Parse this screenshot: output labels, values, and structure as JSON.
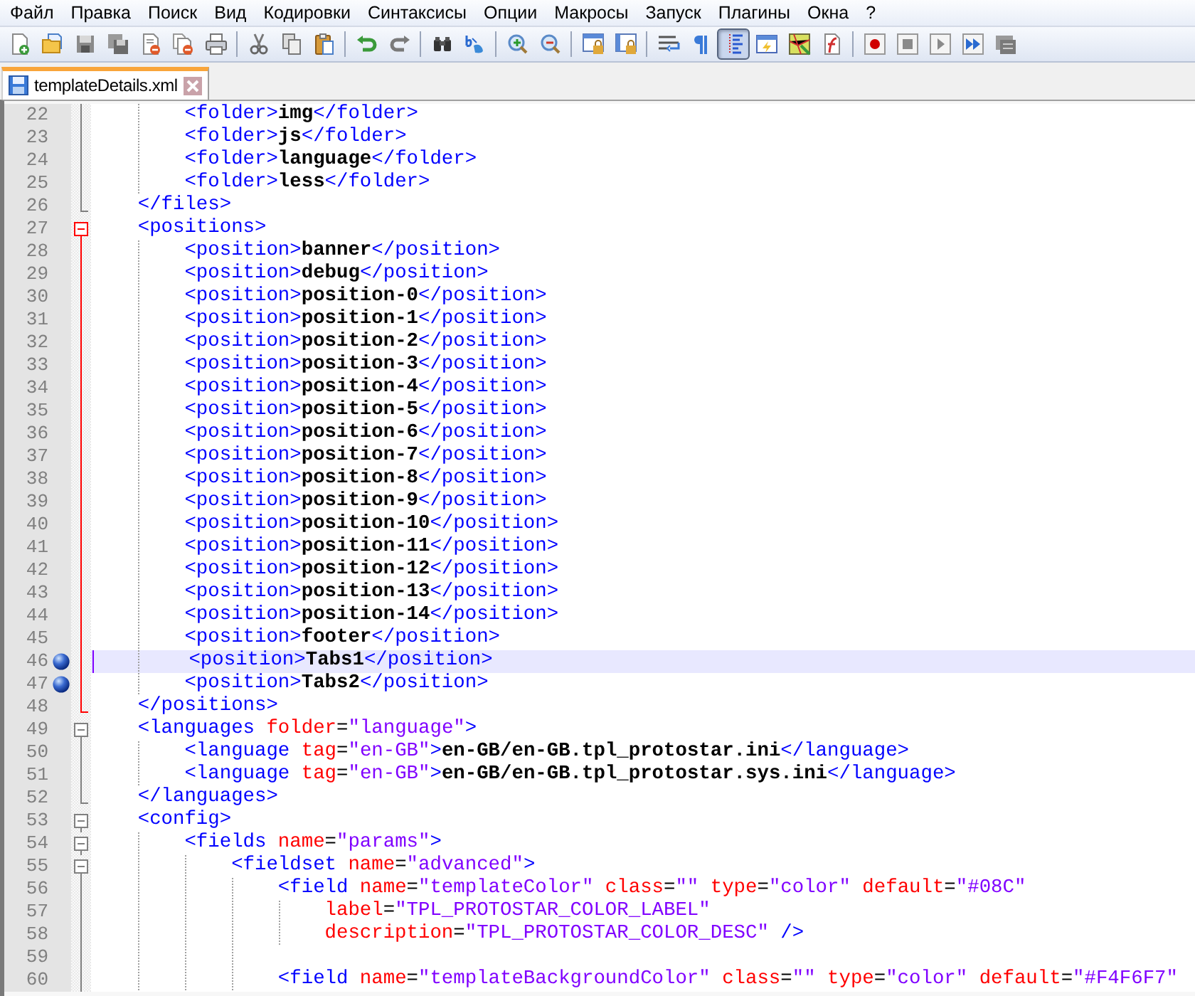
{
  "menu": [
    {
      "label": "Файл"
    },
    {
      "label": "Правка"
    },
    {
      "label": "Поиск"
    },
    {
      "label": "Вид"
    },
    {
      "label": "Кодировки"
    },
    {
      "label": "Синтаксисы"
    },
    {
      "label": "Опции"
    },
    {
      "label": "Макросы"
    },
    {
      "label": "Запуск"
    },
    {
      "label": "Плагины"
    },
    {
      "label": "Окна"
    },
    {
      "label": "?"
    }
  ],
  "toolbar": [
    {
      "kind": "new",
      "pressed": false
    },
    {
      "kind": "open",
      "pressed": false
    },
    {
      "kind": "save",
      "pressed": false
    },
    {
      "kind": "save-all",
      "pressed": false
    },
    {
      "kind": "close",
      "pressed": false
    },
    {
      "kind": "close-all",
      "pressed": false
    },
    {
      "kind": "print",
      "pressed": false
    },
    {
      "kind": "separator"
    },
    {
      "kind": "cut",
      "pressed": false
    },
    {
      "kind": "copy",
      "pressed": false
    },
    {
      "kind": "paste",
      "pressed": false
    },
    {
      "kind": "separator"
    },
    {
      "kind": "undo",
      "pressed": false
    },
    {
      "kind": "redo",
      "pressed": false
    },
    {
      "kind": "separator"
    },
    {
      "kind": "find",
      "pressed": false
    },
    {
      "kind": "replace",
      "pressed": false
    },
    {
      "kind": "separator"
    },
    {
      "kind": "zoom-in",
      "pressed": false
    },
    {
      "kind": "zoom-out",
      "pressed": false
    },
    {
      "kind": "separator"
    },
    {
      "kind": "sync-vertical",
      "pressed": false
    },
    {
      "kind": "sync-horizontal",
      "pressed": false
    },
    {
      "kind": "separator"
    },
    {
      "kind": "wrap",
      "pressed": false
    },
    {
      "kind": "all-chars",
      "pressed": false
    },
    {
      "kind": "indent-guide",
      "pressed": true
    },
    {
      "kind": "language",
      "pressed": false
    },
    {
      "kind": "doc-map",
      "pressed": false
    },
    {
      "kind": "function-list",
      "pressed": false
    },
    {
      "kind": "separator"
    },
    {
      "kind": "record",
      "pressed": false
    },
    {
      "kind": "stop",
      "pressed": false
    },
    {
      "kind": "play",
      "pressed": false
    },
    {
      "kind": "play-multiple",
      "pressed": false
    },
    {
      "kind": "save-macro",
      "pressed": false
    }
  ],
  "tabs": [
    {
      "title": "templateDetails.xml",
      "selected": true
    }
  ],
  "lines": [
    {
      "number": "22",
      "kind": "body",
      "highlighted": false,
      "bookmark": false,
      "current": false,
      "tokens": [
        {
          "kind": "tag",
          "text": "        <folder>"
        },
        {
          "kind": "text",
          "text": "img"
        },
        {
          "kind": "tag",
          "text": "</folder>"
        }
      ]
    },
    {
      "number": "23",
      "kind": "body",
      "highlighted": false,
      "bookmark": false,
      "current": false,
      "tokens": [
        {
          "kind": "tag",
          "text": "        <folder>"
        },
        {
          "kind": "text",
          "text": "js"
        },
        {
          "kind": "tag",
          "text": "</folder>"
        }
      ]
    },
    {
      "number": "24",
      "kind": "body",
      "highlighted": false,
      "bookmark": false,
      "current": false,
      "tokens": [
        {
          "kind": "tag",
          "text": "        <folder>"
        },
        {
          "kind": "text",
          "text": "language"
        },
        {
          "kind": "tag",
          "text": "</folder>"
        }
      ]
    },
    {
      "number": "25",
      "kind": "body",
      "highlighted": false,
      "bookmark": false,
      "current": false,
      "tokens": [
        {
          "kind": "tag",
          "text": "        <folder>"
        },
        {
          "kind": "text",
          "text": "less"
        },
        {
          "kind": "tag",
          "text": "</folder>"
        }
      ]
    },
    {
      "number": "26",
      "kind": "end",
      "highlighted": false,
      "bookmark": false,
      "current": false,
      "tokens": [
        {
          "kind": "tag",
          "text": "    </files>"
        }
      ]
    },
    {
      "number": "27",
      "kind": "open",
      "highlighted": true,
      "bookmark": false,
      "current": false,
      "tokens": [
        {
          "kind": "tag",
          "text": "    <positions>"
        }
      ]
    },
    {
      "number": "28",
      "kind": "body",
      "highlighted": true,
      "bookmark": false,
      "current": false,
      "tokens": [
        {
          "kind": "tag",
          "text": "        <position>"
        },
        {
          "kind": "text",
          "text": "banner"
        },
        {
          "kind": "tag",
          "text": "</position>"
        }
      ]
    },
    {
      "number": "29",
      "kind": "body",
      "highlighted": true,
      "bookmark": false,
      "current": false,
      "tokens": [
        {
          "kind": "tag",
          "text": "        <position>"
        },
        {
          "kind": "text",
          "text": "debug"
        },
        {
          "kind": "tag",
          "text": "</position>"
        }
      ]
    },
    {
      "number": "30",
      "kind": "body",
      "highlighted": true,
      "bookmark": false,
      "current": false,
      "tokens": [
        {
          "kind": "tag",
          "text": "        <position>"
        },
        {
          "kind": "text",
          "text": "position-0"
        },
        {
          "kind": "tag",
          "text": "</position>"
        }
      ]
    },
    {
      "number": "31",
      "kind": "body",
      "highlighted": true,
      "bookmark": false,
      "current": false,
      "tokens": [
        {
          "kind": "tag",
          "text": "        <position>"
        },
        {
          "kind": "text",
          "text": "position-1"
        },
        {
          "kind": "tag",
          "text": "</position>"
        }
      ]
    },
    {
      "number": "32",
      "kind": "body",
      "highlighted": true,
      "bookmark": false,
      "current": false,
      "tokens": [
        {
          "kind": "tag",
          "text": "        <position>"
        },
        {
          "kind": "text",
          "text": "position-2"
        },
        {
          "kind": "tag",
          "text": "</position>"
        }
      ]
    },
    {
      "number": "33",
      "kind": "body",
      "highlighted": true,
      "bookmark": false,
      "current": false,
      "tokens": [
        {
          "kind": "tag",
          "text": "        <position>"
        },
        {
          "kind": "text",
          "text": "position-3"
        },
        {
          "kind": "tag",
          "text": "</position>"
        }
      ]
    },
    {
      "number": "34",
      "kind": "body",
      "highlighted": true,
      "bookmark": false,
      "current": false,
      "tokens": [
        {
          "kind": "tag",
          "text": "        <position>"
        },
        {
          "kind": "text",
          "text": "position-4"
        },
        {
          "kind": "tag",
          "text": "</position>"
        }
      ]
    },
    {
      "number": "35",
      "kind": "body",
      "highlighted": true,
      "bookmark": false,
      "current": false,
      "tokens": [
        {
          "kind": "tag",
          "text": "        <position>"
        },
        {
          "kind": "text",
          "text": "position-5"
        },
        {
          "kind": "tag",
          "text": "</position>"
        }
      ]
    },
    {
      "number": "36",
      "kind": "body",
      "highlighted": true,
      "bookmark": false,
      "current": false,
      "tokens": [
        {
          "kind": "tag",
          "text": "        <position>"
        },
        {
          "kind": "text",
          "text": "position-6"
        },
        {
          "kind": "tag",
          "text": "</position>"
        }
      ]
    },
    {
      "number": "37",
      "kind": "body",
      "highlighted": true,
      "bookmark": false,
      "current": false,
      "tokens": [
        {
          "kind": "tag",
          "text": "        <position>"
        },
        {
          "kind": "text",
          "text": "position-7"
        },
        {
          "kind": "tag",
          "text": "</position>"
        }
      ]
    },
    {
      "number": "38",
      "kind": "body",
      "highlighted": true,
      "bookmark": false,
      "current": false,
      "tokens": [
        {
          "kind": "tag",
          "text": "        <position>"
        },
        {
          "kind": "text",
          "text": "position-8"
        },
        {
          "kind": "tag",
          "text": "</position>"
        }
      ]
    },
    {
      "number": "39",
      "kind": "body",
      "highlighted": true,
      "bookmark": false,
      "current": false,
      "tokens": [
        {
          "kind": "tag",
          "text": "        <position>"
        },
        {
          "kind": "text",
          "text": "position-9"
        },
        {
          "kind": "tag",
          "text": "</position>"
        }
      ]
    },
    {
      "number": "40",
      "kind": "body",
      "highlighted": true,
      "bookmark": false,
      "current": false,
      "tokens": [
        {
          "kind": "tag",
          "text": "        <position>"
        },
        {
          "kind": "text",
          "text": "position-10"
        },
        {
          "kind": "tag",
          "text": "</position>"
        }
      ]
    },
    {
      "number": "41",
      "kind": "body",
      "highlighted": true,
      "bookmark": false,
      "current": false,
      "tokens": [
        {
          "kind": "tag",
          "text": "        <position>"
        },
        {
          "kind": "text",
          "text": "position-11"
        },
        {
          "kind": "tag",
          "text": "</position>"
        }
      ]
    },
    {
      "number": "42",
      "kind": "body",
      "highlighted": true,
      "bookmark": false,
      "current": false,
      "tokens": [
        {
          "kind": "tag",
          "text": "        <position>"
        },
        {
          "kind": "text",
          "text": "position-12"
        },
        {
          "kind": "tag",
          "text": "</position>"
        }
      ]
    },
    {
      "number": "43",
      "kind": "body",
      "highlighted": true,
      "bookmark": false,
      "current": false,
      "tokens": [
        {
          "kind": "tag",
          "text": "        <position>"
        },
        {
          "kind": "text",
          "text": "position-13"
        },
        {
          "kind": "tag",
          "text": "</position>"
        }
      ]
    },
    {
      "number": "44",
      "kind": "body",
      "highlighted": true,
      "bookmark": false,
      "current": false,
      "tokens": [
        {
          "kind": "tag",
          "text": "        <position>"
        },
        {
          "kind": "text",
          "text": "position-14"
        },
        {
          "kind": "tag",
          "text": "</position>"
        }
      ]
    },
    {
      "number": "45",
      "kind": "body",
      "highlighted": true,
      "bookmark": false,
      "current": false,
      "tokens": [
        {
          "kind": "tag",
          "text": "        <position>"
        },
        {
          "kind": "text",
          "text": "footer"
        },
        {
          "kind": "tag",
          "text": "</position>"
        }
      ]
    },
    {
      "number": "46",
      "kind": "body",
      "highlighted": true,
      "bookmark": true,
      "current": true,
      "tokens": [
        {
          "kind": "tag",
          "text": "        <position>"
        },
        {
          "kind": "text",
          "text": "Tabs1"
        },
        {
          "kind": "tag",
          "text": "</position>"
        }
      ]
    },
    {
      "number": "47",
      "kind": "body",
      "highlighted": true,
      "bookmark": true,
      "current": false,
      "tokens": [
        {
          "kind": "tag",
          "text": "        <position>"
        },
        {
          "kind": "text",
          "text": "Tabs2"
        },
        {
          "kind": "tag",
          "text": "</position>"
        }
      ]
    },
    {
      "number": "48",
      "kind": "end",
      "highlighted": true,
      "bookmark": false,
      "current": false,
      "tokens": [
        {
          "kind": "tag",
          "text": "    </positions>"
        }
      ]
    },
    {
      "number": "49",
      "kind": "open",
      "highlighted": false,
      "bookmark": false,
      "current": false,
      "tokens": [
        {
          "kind": "tag",
          "text": "    <languages "
        },
        {
          "kind": "attr",
          "text": "folder"
        },
        {
          "kind": "symbol",
          "text": "="
        },
        {
          "kind": "value",
          "text": "\"language\""
        },
        {
          "kind": "tag",
          "text": ">"
        }
      ]
    },
    {
      "number": "50",
      "kind": "body",
      "highlighted": false,
      "bookmark": false,
      "current": false,
      "tokens": [
        {
          "kind": "tag",
          "text": "        <language "
        },
        {
          "kind": "attr",
          "text": "tag"
        },
        {
          "kind": "symbol",
          "text": "="
        },
        {
          "kind": "value",
          "text": "\"en-GB\""
        },
        {
          "kind": "tag",
          "text": ">"
        },
        {
          "kind": "text",
          "text": "en-GB/en-GB.tpl_protostar.ini"
        },
        {
          "kind": "tag",
          "text": "</language>"
        }
      ]
    },
    {
      "number": "51",
      "kind": "body",
      "highlighted": false,
      "bookmark": false,
      "current": false,
      "tokens": [
        {
          "kind": "tag",
          "text": "        <language "
        },
        {
          "kind": "attr",
          "text": "tag"
        },
        {
          "kind": "symbol",
          "text": "="
        },
        {
          "kind": "value",
          "text": "\"en-GB\""
        },
        {
          "kind": "tag",
          "text": ">"
        },
        {
          "kind": "text",
          "text": "en-GB/en-GB.tpl_protostar.sys.ini"
        },
        {
          "kind": "tag",
          "text": "</language>"
        }
      ]
    },
    {
      "number": "52",
      "kind": "end",
      "highlighted": false,
      "bookmark": false,
      "current": false,
      "tokens": [
        {
          "kind": "tag",
          "text": "    </languages>"
        }
      ]
    },
    {
      "number": "53",
      "kind": "open",
      "highlighted": false,
      "bookmark": false,
      "current": false,
      "tokens": [
        {
          "kind": "tag",
          "text": "    <config>"
        }
      ]
    },
    {
      "number": "54",
      "kind": "open",
      "highlighted": false,
      "bookmark": false,
      "current": false,
      "tokens": [
        {
          "kind": "tag",
          "text": "        <fields "
        },
        {
          "kind": "attr",
          "text": "name"
        },
        {
          "kind": "symbol",
          "text": "="
        },
        {
          "kind": "value",
          "text": "\"params\""
        },
        {
          "kind": "tag",
          "text": ">"
        }
      ]
    },
    {
      "number": "55",
      "kind": "open",
      "highlighted": false,
      "bookmark": false,
      "current": false,
      "tokens": [
        {
          "kind": "tag",
          "text": "            <fieldset "
        },
        {
          "kind": "attr",
          "text": "name"
        },
        {
          "kind": "symbol",
          "text": "="
        },
        {
          "kind": "value",
          "text": "\"advanced\""
        },
        {
          "kind": "tag",
          "text": ">"
        }
      ]
    },
    {
      "number": "56",
      "kind": "body",
      "highlighted": false,
      "bookmark": false,
      "current": false,
      "tokens": [
        {
          "kind": "tag",
          "text": "                <field "
        },
        {
          "kind": "attr",
          "text": "name"
        },
        {
          "kind": "symbol",
          "text": "="
        },
        {
          "kind": "value",
          "text": "\"templateColor\" "
        },
        {
          "kind": "attr",
          "text": "class"
        },
        {
          "kind": "symbol",
          "text": "="
        },
        {
          "kind": "value",
          "text": "\"\" "
        },
        {
          "kind": "attr",
          "text": "type"
        },
        {
          "kind": "symbol",
          "text": "="
        },
        {
          "kind": "value",
          "text": "\"color\" "
        },
        {
          "kind": "attr",
          "text": "default"
        },
        {
          "kind": "symbol",
          "text": "="
        },
        {
          "kind": "value",
          "text": "\"#08C\""
        }
      ]
    },
    {
      "number": "57",
      "kind": "body",
      "highlighted": false,
      "bookmark": false,
      "current": false,
      "tokens": [
        {
          "kind": "attr",
          "text": "                    label"
        },
        {
          "kind": "symbol",
          "text": "="
        },
        {
          "kind": "value",
          "text": "\"TPL_PROTOSTAR_COLOR_LABEL\""
        }
      ]
    },
    {
      "number": "58",
      "kind": "body",
      "highlighted": false,
      "bookmark": false,
      "current": false,
      "tokens": [
        {
          "kind": "attr",
          "text": "                    description"
        },
        {
          "kind": "symbol",
          "text": "="
        },
        {
          "kind": "value",
          "text": "\"TPL_PROTOSTAR_COLOR_DESC\" "
        },
        {
          "kind": "tag",
          "text": "/>"
        }
      ]
    },
    {
      "number": "59",
      "kind": "body",
      "highlighted": false,
      "bookmark": false,
      "current": false
    },
    {
      "number": "60",
      "kind": "body",
      "highlighted": false,
      "bookmark": false,
      "current": false,
      "tokens": [
        {
          "kind": "tag",
          "text": "                <field "
        },
        {
          "kind": "attr",
          "text": "name"
        },
        {
          "kind": "symbol",
          "text": "="
        },
        {
          "kind": "value",
          "text": "\"templateBackgroundColor\" "
        },
        {
          "kind": "attr",
          "text": "class"
        },
        {
          "kind": "symbol",
          "text": "="
        },
        {
          "kind": "value",
          "text": "\"\" "
        },
        {
          "kind": "attr",
          "text": "type"
        },
        {
          "kind": "symbol",
          "text": "="
        },
        {
          "kind": "value",
          "text": "\"color\" "
        },
        {
          "kind": "attr",
          "text": "default"
        },
        {
          "kind": "symbol",
          "text": "="
        },
        {
          "kind": "value",
          "text": "\"#F4F6F7\""
        }
      ]
    }
  ]
}
